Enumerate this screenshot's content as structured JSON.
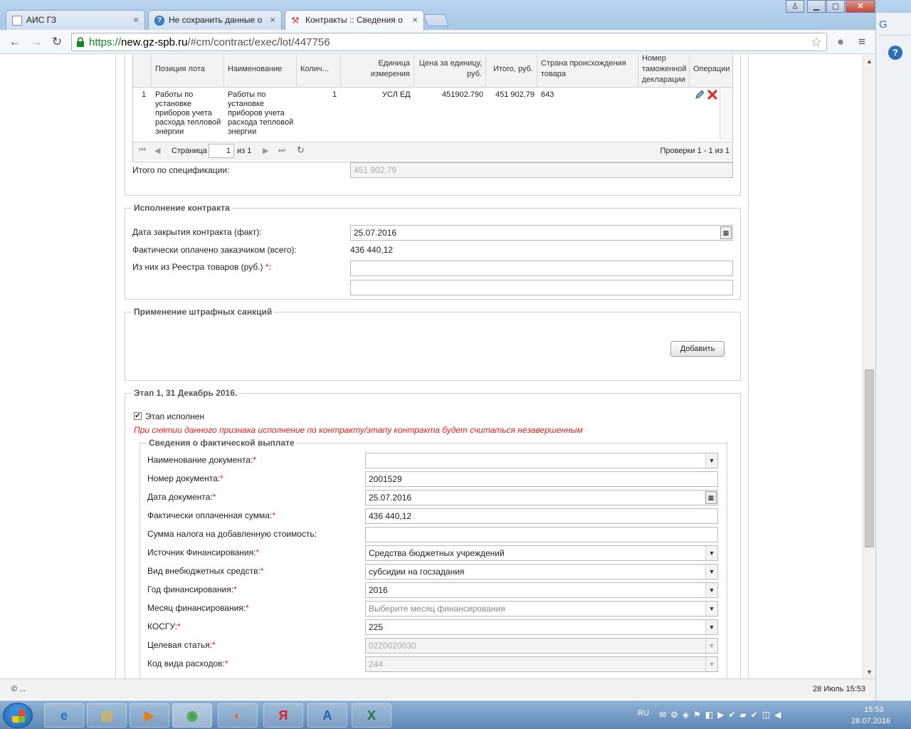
{
  "browser": {
    "tabs": [
      {
        "title": "АИС ГЗ"
      },
      {
        "title": "Не сохранить данные о"
      },
      {
        "title": "Контракты :: Сведения о"
      }
    ],
    "url_scheme": "https://",
    "url_host": "new.gz-spb.ru",
    "url_path": "/#cm/contract/exec/lot/447756"
  },
  "spec_table": {
    "headers": [
      "Позиция лота",
      "Наименование",
      "Колич...",
      "Единица измерения",
      "Цена за единицу, руб.",
      "Итого, руб.",
      "Страна происхождения товара",
      "Номер таможенной декларации",
      "Операции"
    ],
    "row": {
      "num": "1",
      "position": "Работы по установке приборов учета расхода тепловой энергии",
      "name": "Работы по установке приборов учета расхода тепловой энергии",
      "qty": "1",
      "unit": "УСЛ ЕД",
      "price": "451902.790",
      "total": "451 902,79",
      "country": "643",
      "declaration": ""
    },
    "pager": {
      "page_label": "Страница",
      "page_value": "1",
      "of_label": "из 1",
      "records": "Проверки 1 - 1 из 1"
    },
    "total_label": "Итого по спецификации:",
    "total_value": "451 902,79"
  },
  "execution": {
    "legend": "Исполнение контракта",
    "close_date_label": "Дата закрытия контракта (факт):",
    "close_date_value": "25.07.2016",
    "paid_label": "Фактически оплачено заказчиком (всего):",
    "paid_value": "436 440,12",
    "registry_label": "Из них из Реестра товаров (руб.)",
    "registry_value": "",
    "extra_value": ""
  },
  "penalties": {
    "legend": "Применение штрафных санкций",
    "add_button": "Добавить"
  },
  "stage": {
    "legend": "Этап 1, 31 Декабрь 2016.",
    "done_label": "Этап исполнен",
    "warning": "При снятии данного признака исполнение по контракту/этапу контракта будет считаться незавершенным",
    "payment_legend": "Сведения о фактической выплате",
    "fields": {
      "doc_name": {
        "label": "Наименование документа:",
        "value": ""
      },
      "doc_number": {
        "label": "Номер документа:",
        "value": "2001529"
      },
      "doc_date": {
        "label": "Дата документа:",
        "value": "25.07.2016"
      },
      "paid_sum": {
        "label": "Фактически оплаченная сумма:",
        "value": "436 440,12"
      },
      "vat_sum": {
        "label": "Сумма налога на добавленную стоимость:",
        "value": ""
      },
      "fin_source": {
        "label": "Источник Финансирования:",
        "value": "Средства бюджетных учреждений"
      },
      "offbudget": {
        "label": "Вид внебюджетных средств:",
        "value": "субсидии на госзадания"
      },
      "fin_year": {
        "label": "Год финансирования:",
        "value": "2016"
      },
      "fin_month": {
        "label": "Месяц финансирования:",
        "placeholder": "Выберите месяц финансирования"
      },
      "kosgu": {
        "label": "КОСГУ:",
        "value": "225"
      },
      "target": {
        "label": "Целевая статья:",
        "value": "0220020030"
      },
      "expense_code": {
        "label": "Код вида расходов:",
        "value": "244"
      }
    }
  },
  "status_bar": {
    "left": "© ...",
    "right": "28 Июль 15:53"
  },
  "taskbar": {
    "lang": "RU",
    "time": "15:53",
    "date": "28.07.2016"
  },
  "colors": {
    "required": "#e02020",
    "warning_text": "#e02020",
    "taskbar": "#5c86b3"
  }
}
